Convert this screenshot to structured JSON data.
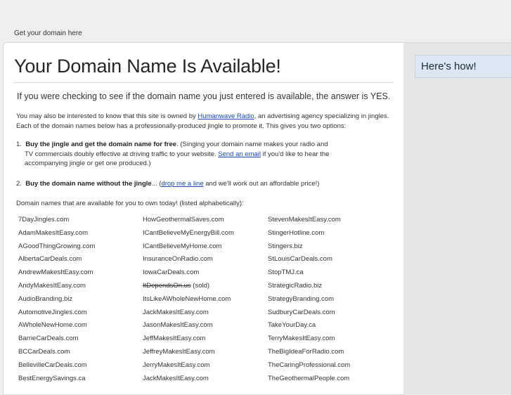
{
  "topbar": {
    "label": "Get your domain here"
  },
  "sidebar": {
    "heres_how": "Here's how!"
  },
  "main": {
    "title": "Your Domain Name Is Available!",
    "lead": "If you were checking to see if the domain name you just entered is available, the answer is YES.",
    "intro_1a": "You may also be interested to know that this site is owned by ",
    "intro_link": "Humanwave Radio",
    "intro_1b": ", an advertising agency specializing in jingles.",
    "intro_2": "Each of the domain names below has a professionally-produced jingle to promote it.  This gives you two options:",
    "option1_num": "1.",
    "option1_bold": "Buy the jingle and get the domain name for free",
    "option1_text_a": ".  (Singing your domain name makes your radio and",
    "option1_text_b": "TV commercials doubly effective at driving traffic to your website.  ",
    "option1_link": "Send an email",
    "option1_text_c": " if you'd like to hear the",
    "option1_text_d": "accompanying jingle or get one produced.)",
    "option2_num": "2.",
    "option2_bold": "Buy the domain name without the jingle",
    "option2_text_a": "... (",
    "option2_link": "drop me a line",
    "option2_text_b": " and we'll work out an affordable price!)",
    "list_intro": "Domain names that are available for you to own today!  (listed alphabetically):"
  },
  "domains": {
    "col1": [
      "7DayJingles.com",
      "AdamMakesItEasy.com",
      "AGoodThingGrowing.com",
      "AlbertaCarDeals.com",
      "AndrewMakesItEasy.com",
      "AndyMakesItEasy.com",
      "AudioBranding.biz",
      "AutomotiveJingles.com",
      "AWholeNewHome.com",
      "BarrieCarDeals.com",
      "BCCarDeals.com",
      "BellevilleCarDeals.com",
      "BestEnergySavings.ca"
    ],
    "col2": [
      "HowGeothermalSaves.com",
      "ICantBelieveMyEnergyBill.com",
      "ICantBelieveMyHome.com",
      "InsuranceOnRadio.com",
      "IowaCarDeals.com",
      "ItDependsOn.us",
      "ItsLikeAWholeNewHome.com",
      "JackMakesItEasy.com",
      "JasonMakesItEasy.com",
      "JeffMakesItEasy.com",
      "JeffreyMakesItEasy.com",
      "JerryMakesItEasy.com",
      "JackMakesItEasy.com"
    ],
    "col2_sold_suffix": " (sold)",
    "col3": [
      "StevenMakesItEasy.com",
      "StingerHotline.com",
      "Stingers.biz",
      "StLouisCarDeals.com",
      "StopTMJ.ca",
      "StrategicRadio.biz",
      "StrategyBranding.com",
      "SudburyCarDeals.com",
      "TakeYourDay.ca",
      "TerryMakesItEasy.com",
      "TheBigIdeaForRadio.com",
      "TheCaringProfessional.com",
      "TheGeothermalPeople.com"
    ]
  }
}
